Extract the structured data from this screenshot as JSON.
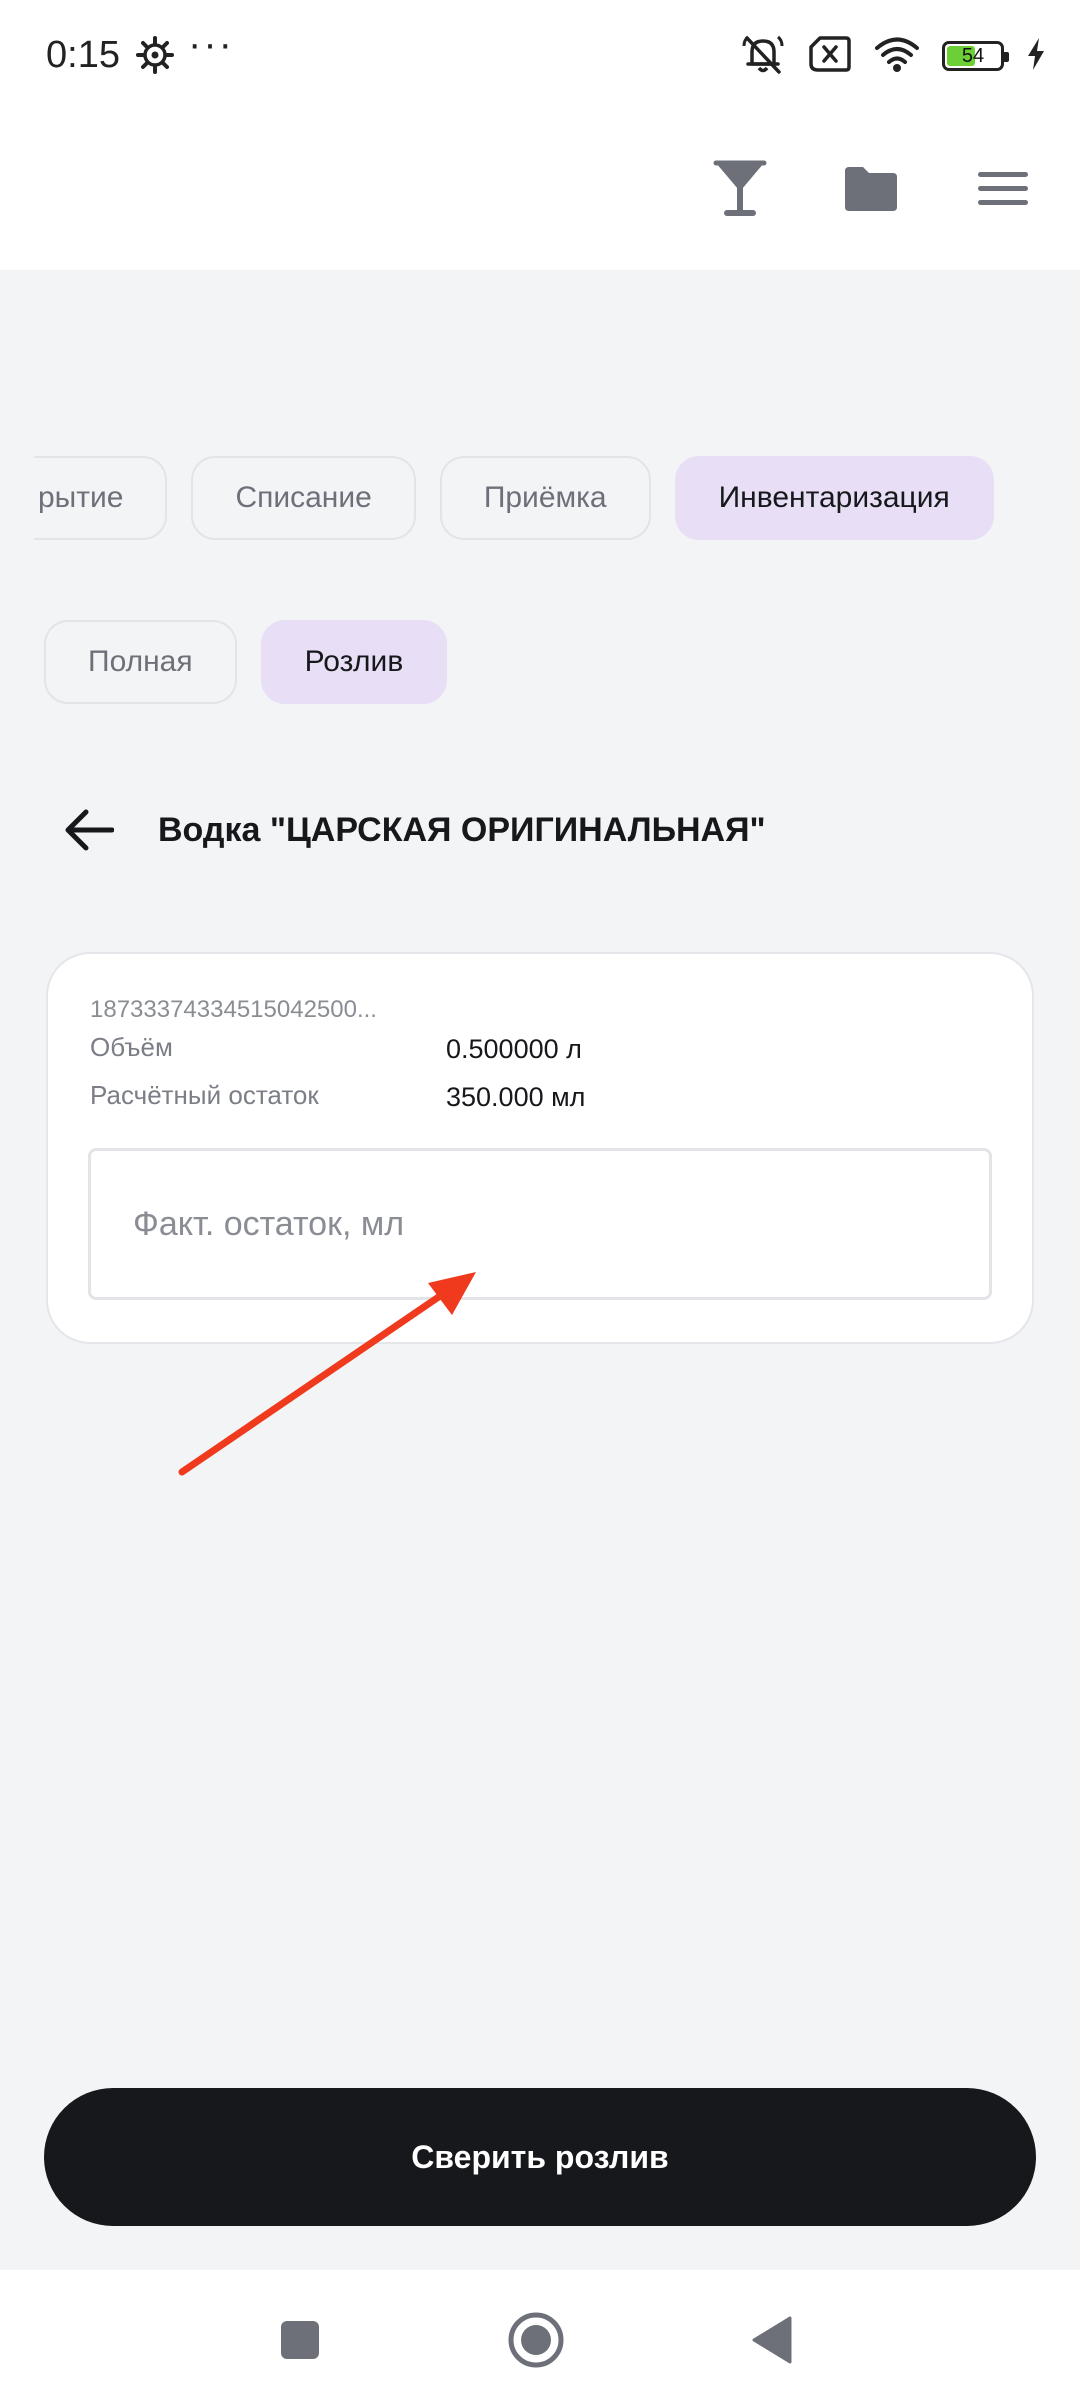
{
  "status_bar": {
    "time": "0:15",
    "more": "···",
    "battery_level": "54",
    "battery_fraction": 0.54
  },
  "app_bar": {
    "icons": [
      "cocktail-glass-icon",
      "folder-icon",
      "menu-icon"
    ]
  },
  "operation_tabs": [
    {
      "label": "рытие",
      "active": false
    },
    {
      "label": "Списание",
      "active": false
    },
    {
      "label": "Приёмка",
      "active": false
    },
    {
      "label": "Инвентаризация",
      "active": true
    }
  ],
  "inventory_tabs": [
    {
      "label": "Полная",
      "active": false
    },
    {
      "label": "Розлив",
      "active": true
    }
  ],
  "page": {
    "title": "Водка \"ЦАРСКАЯ ОРИГИНАЛЬНАЯ\""
  },
  "bottle_card": {
    "barcode": "18733374334515042500...",
    "volume_label": "Объём",
    "volume_value": "0.500000 л",
    "calc_rest_label": "Расчётный остаток",
    "calc_rest_value": "350.000 мл",
    "fact_input": {
      "value": "",
      "placeholder": "Факт. остаток, мл"
    }
  },
  "primary_action": {
    "label": "Сверить розлив"
  },
  "colors": {
    "background": "#f3f4f6",
    "active_chip": "#e8dff6",
    "primary_button": "#17181c",
    "annotation_arrow": "#f03a1e"
  }
}
